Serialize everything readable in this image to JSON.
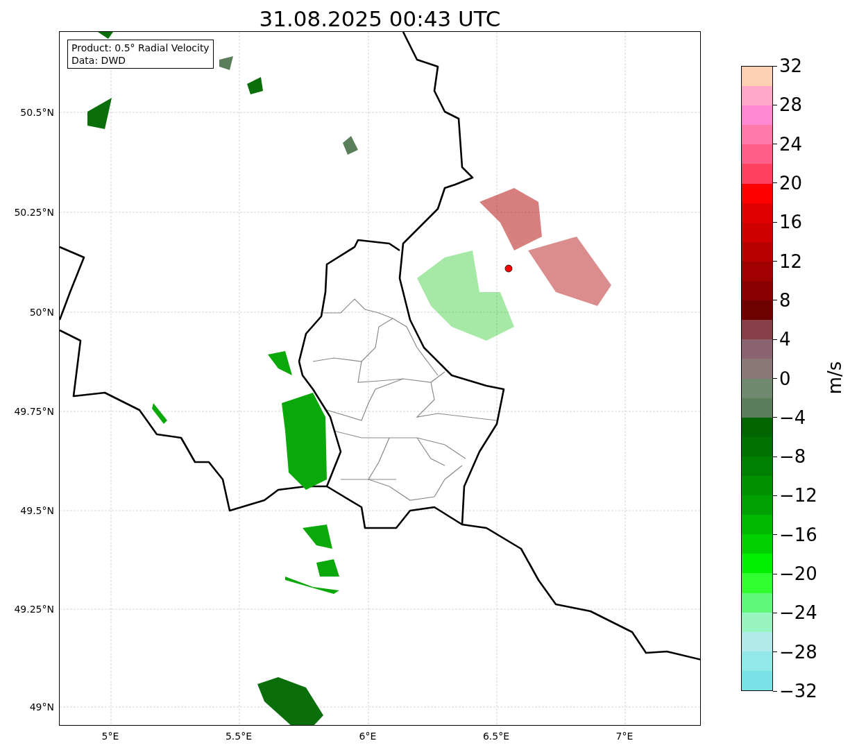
{
  "title": "31.08.2025 00:43 UTC",
  "info_box": [
    "Product: 0.5° Radial Velocity",
    "Data: DWD"
  ],
  "map": {
    "y_ticks": [
      "50.5°N",
      "50.25°N",
      "50°N",
      "49.75°N",
      "49.5°N",
      "49.25°N",
      "49°N"
    ],
    "x_ticks": [
      "5°E",
      "5.5°E",
      "6°E",
      "6.5°E",
      "7°E"
    ]
  },
  "colorbar": {
    "label": "m/s",
    "ticks": [
      "32",
      "28",
      "24",
      "20",
      "16",
      "12",
      "8",
      "4",
      "0",
      "−4",
      "−8",
      "−12",
      "−16",
      "−20",
      "−24",
      "−28",
      "−32"
    ],
    "segments": [
      {
        "color": "#fdd0b1"
      },
      {
        "color": "#ffa8c8"
      },
      {
        "color": "#ff88d0"
      },
      {
        "color": "#ff78a8"
      },
      {
        "color": "#ff5f8a"
      },
      {
        "color": "#ff4060"
      },
      {
        "color": "#ff0000"
      },
      {
        "color": "#e00000"
      },
      {
        "color": "#d00000"
      },
      {
        "color": "#b80000"
      },
      {
        "color": "#a00000"
      },
      {
        "color": "#8a0000"
      },
      {
        "color": "#6e0000"
      },
      {
        "color": "#884048"
      },
      {
        "color": "#8a6470"
      },
      {
        "color": "#8a7878"
      },
      {
        "color": "#708a70"
      },
      {
        "color": "#5a7d5a"
      },
      {
        "color": "#006400"
      },
      {
        "color": "#007000"
      },
      {
        "color": "#008000"
      },
      {
        "color": "#009000"
      },
      {
        "color": "#00a000"
      },
      {
        "color": "#00b800"
      },
      {
        "color": "#00d000"
      },
      {
        "color": "#00f000"
      },
      {
        "color": "#30ff30"
      },
      {
        "color": "#60f878"
      },
      {
        "color": "#98f5c0"
      },
      {
        "color": "#b0eaea"
      },
      {
        "color": "#90e8e8"
      },
      {
        "color": "#78e2e6"
      }
    ]
  }
}
